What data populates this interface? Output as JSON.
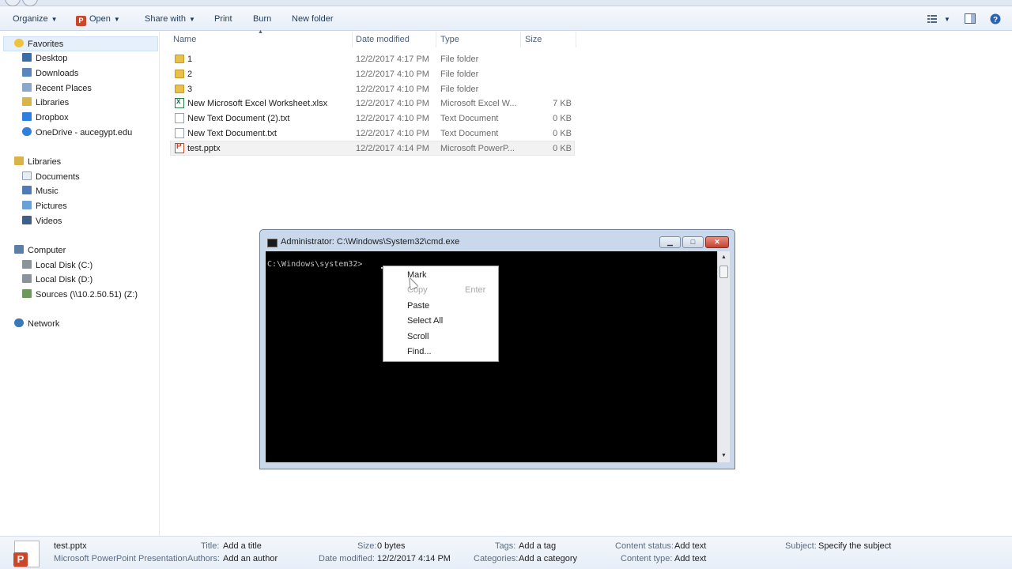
{
  "toolbar": {
    "organize": "Organize",
    "open": "Open",
    "share_with": "Share with",
    "print": "Print",
    "burn": "Burn",
    "new_folder": "New folder"
  },
  "nav": {
    "favorites": "Favorites",
    "desktop": "Desktop",
    "downloads": "Downloads",
    "recent_places": "Recent Places",
    "libraries_fav": "Libraries",
    "dropbox": "Dropbox",
    "onedrive": "OneDrive - aucegypt.edu",
    "libraries": "Libraries",
    "documents": "Documents",
    "music": "Music",
    "pictures": "Pictures",
    "videos": "Videos",
    "computer": "Computer",
    "local_c": "Local Disk (C:)",
    "local_d": "Local Disk (D:)",
    "sources": "Sources (\\\\10.2.50.51) (Z:)",
    "network": "Network"
  },
  "columns": {
    "name": "Name",
    "date_modified": "Date modified",
    "type": "Type",
    "size": "Size"
  },
  "files": [
    {
      "name": "1",
      "date": "12/2/2017 4:17 PM",
      "type": "File folder",
      "size": "",
      "icon": "folder-icon"
    },
    {
      "name": "2",
      "date": "12/2/2017 4:10 PM",
      "type": "File folder",
      "size": "",
      "icon": "folder-icon"
    },
    {
      "name": "3",
      "date": "12/2/2017 4:10 PM",
      "type": "File folder",
      "size": "",
      "icon": "folder-icon"
    },
    {
      "name": "New Microsoft Excel Worksheet.xlsx",
      "date": "12/2/2017 4:10 PM",
      "type": "Microsoft Excel W...",
      "size": "7 KB",
      "icon": "excel-file-icon"
    },
    {
      "name": "New Text Document (2).txt",
      "date": "12/2/2017 4:10 PM",
      "type": "Text Document",
      "size": "0 KB",
      "icon": "text-file-icon"
    },
    {
      "name": "New Text Document.txt",
      "date": "12/2/2017 4:10 PM",
      "type": "Text Document",
      "size": "0 KB",
      "icon": "text-file-icon"
    },
    {
      "name": "test.pptx",
      "date": "12/2/2017 4:14 PM",
      "type": "Microsoft PowerP...",
      "size": "0 KB",
      "icon": "powerpoint-file-icon"
    }
  ],
  "cmd": {
    "title": "Administrator: C:\\Windows\\System32\\cmd.exe",
    "prompt": "C:\\Windows\\system32>"
  },
  "context_menu": {
    "mark": "Mark",
    "copy": "Copy",
    "copy_shortcut": "Enter",
    "paste": "Paste",
    "select_all": "Select All",
    "scroll": "Scroll",
    "find": "Find..."
  },
  "details": {
    "filename": "test.pptx",
    "filetype": "Microsoft PowerPoint Presentation",
    "title_label": "Title:",
    "title_value": "Add a title",
    "authors_label": "Authors:",
    "authors_value": "Add an author",
    "size_label": "Size:",
    "size_value": "0 bytes",
    "date_label": "Date modified:",
    "date_value": "12/2/2017 4:14 PM",
    "tags_label": "Tags:",
    "tags_value": "Add a tag",
    "categories_label": "Categories:",
    "categories_value": "Add a category",
    "content_status_label": "Content status:",
    "content_status_value": "Add text",
    "content_type_label": "Content type:",
    "content_type_value": "Add text",
    "subject_label": "Subject:",
    "subject_value": "Specify the subject"
  },
  "colors": {
    "toolbar_text": "#1e395b",
    "console_bg": "#000000",
    "selection": "#e5f0fb"
  }
}
